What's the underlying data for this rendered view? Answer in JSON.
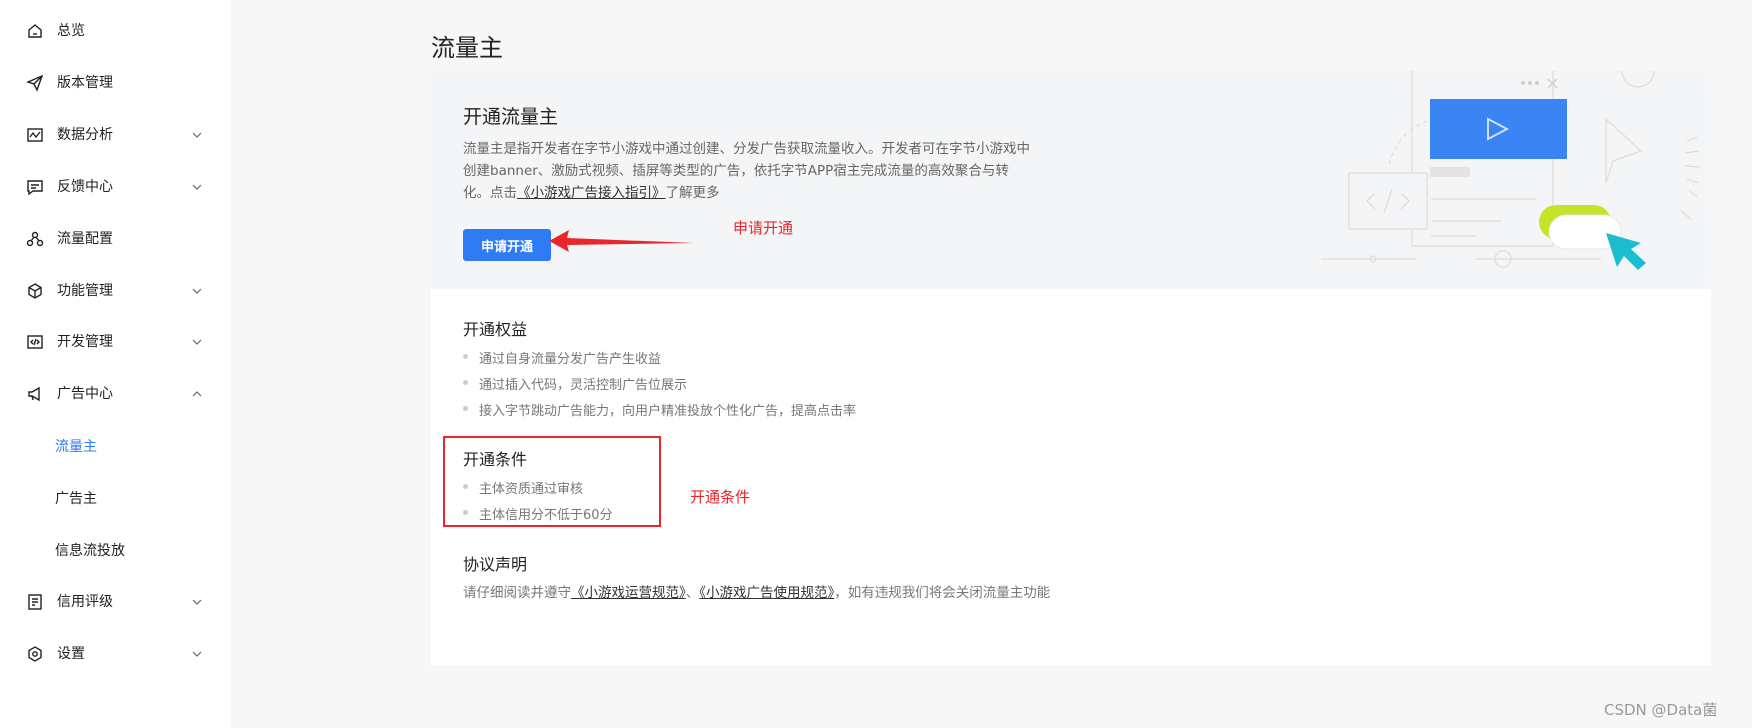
{
  "sidebar": {
    "items": [
      {
        "label": "总览",
        "icon": "home-icon",
        "expandable": false
      },
      {
        "label": "版本管理",
        "icon": "send-icon",
        "expandable": false
      },
      {
        "label": "数据分析",
        "icon": "chart-icon",
        "expandable": true
      },
      {
        "label": "反馈中心",
        "icon": "message-icon",
        "expandable": true
      },
      {
        "label": "流量配置",
        "icon": "flow-icon",
        "expandable": false
      },
      {
        "label": "功能管理",
        "icon": "cube-icon",
        "expandable": true
      },
      {
        "label": "开发管理",
        "icon": "code-icon",
        "expandable": true
      },
      {
        "label": "广告中心",
        "icon": "megaphone-icon",
        "expandable": true,
        "expanded": true
      },
      {
        "label": "信用评级",
        "icon": "list-icon",
        "expandable": true
      },
      {
        "label": "设置",
        "icon": "settings-icon",
        "expandable": true
      }
    ],
    "ad_sub_items": [
      {
        "label": "流量主",
        "active": true
      },
      {
        "label": "广告主",
        "active": false
      },
      {
        "label": "信息流投放",
        "active": false
      }
    ]
  },
  "page": {
    "title": "流量主",
    "open_section": {
      "title": "开通流量主",
      "description_part1": "流量主是指开发者在字节小游戏中通过创建、分发广告获取流量收入。开发者可在字节小游戏中创建banner、激励式视频、插屏等类型的广告，依托字节APP宿主完成流量的高效聚合与转化。点击",
      "description_link": "《小游戏广告接入指引》",
      "description_part2": "了解更多",
      "apply_button": "申请开通"
    },
    "benefits": {
      "title": "开通权益",
      "items": [
        "通过自身流量分发广告产生收益",
        "通过插入代码，灵活控制广告位展示",
        "接入字节跳动广告能力，向用户精准投放个性化广告，提高点击率"
      ]
    },
    "conditions": {
      "title": "开通条件",
      "items": [
        "主体资质通过审核",
        "主体信用分不低于60分"
      ]
    },
    "agreement": {
      "title": "协议声明",
      "part1": "请仔细阅读并遵守",
      "link1": "《小游戏运营规范》",
      "sep": "、",
      "link2": "《小游戏广告使用规范》",
      "part2": "，如有违规我们将会关闭流量主功能"
    }
  },
  "annotations": {
    "apply_note": "申请开通",
    "conditions_note": "开通条件"
  },
  "watermark": "CSDN @Data菌",
  "colors": {
    "accent": "#2f7bf5",
    "annotation_red": "#e8262b",
    "illustration_lime": "#c6e32a",
    "illustration_cyan": "#1bbdd1"
  }
}
